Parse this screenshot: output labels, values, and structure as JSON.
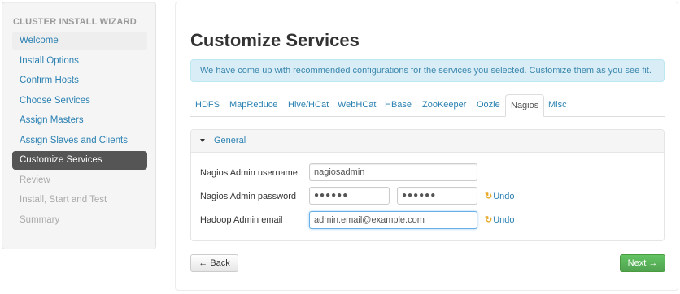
{
  "sidebar": {
    "header": "CLUSTER INSTALL WIZARD",
    "items": [
      {
        "label": "Welcome"
      },
      {
        "label": "Install Options"
      },
      {
        "label": "Confirm Hosts"
      },
      {
        "label": "Choose Services"
      },
      {
        "label": "Assign Masters"
      },
      {
        "label": "Assign Slaves and Clients"
      },
      {
        "label": "Customize Services"
      },
      {
        "label": "Review"
      },
      {
        "label": "Install, Start and Test"
      },
      {
        "label": "Summary"
      }
    ]
  },
  "main": {
    "title": "Customize Services",
    "alert": "We have come up with recommended configurations for the services you selected. Customize them as you see fit.",
    "tabs": [
      "HDFS",
      "MapReduce",
      "Hive/HCat",
      "WebHCat",
      "HBase",
      "ZooKeeper",
      "Oozie",
      "Nagios",
      "Misc"
    ],
    "active_tab": "Nagios",
    "panel": {
      "title": "General",
      "fields": {
        "username_label": "Nagios Admin username",
        "username_value": "nagiosadmin",
        "password_label": "Nagios Admin password",
        "password_value": "●●●●●●",
        "password_confirm_value": "●●●●●●",
        "email_label": "Hadoop Admin email",
        "email_value": "admin.email@example.com"
      },
      "undo_label": "Undo"
    },
    "back_label": "← Back",
    "next_label": "Next →"
  },
  "colors": {
    "link": "#2b81b2",
    "active_nav": "#555555",
    "alert_bg": "#d9edf7",
    "next_button": "#5bb75b",
    "undo_icon": "#e7a92a"
  }
}
